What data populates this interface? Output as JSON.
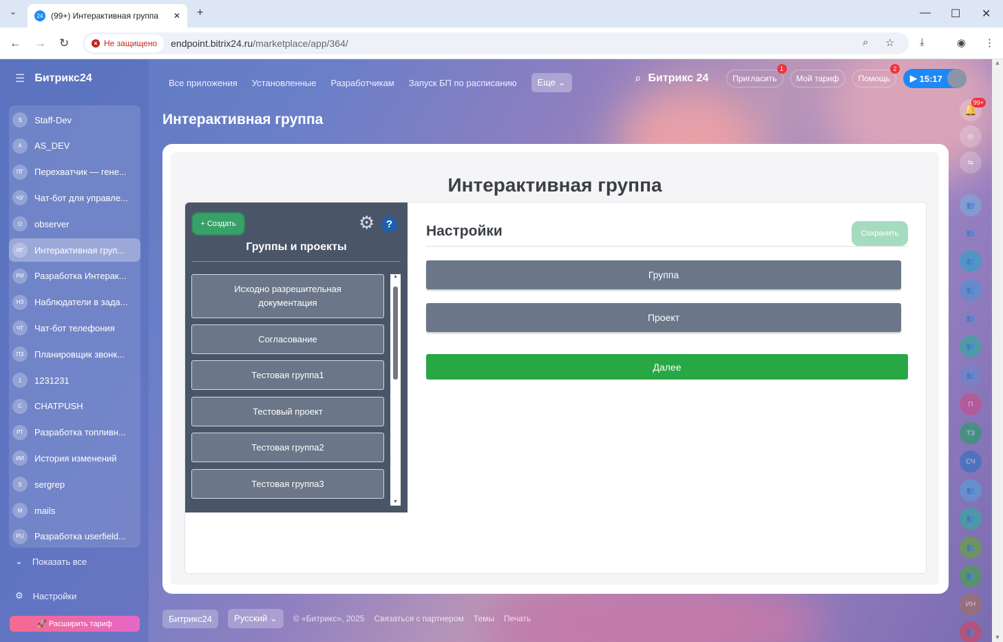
{
  "browser": {
    "tab_title": "(99+) Интерактивная группа",
    "tab_favicon": "24",
    "insecure_label": "Не защищено",
    "url_host": "endpoint.bitrix24.ru",
    "url_path": "/marketplace/app/364/"
  },
  "sidebar": {
    "logo": "Битрикс24",
    "items": [
      {
        "abbr": "S",
        "label": "Staff-Dev"
      },
      {
        "abbr": "A",
        "label": "AS_DEV"
      },
      {
        "abbr": "ПГ",
        "label": "Перехватчик — гене..."
      },
      {
        "abbr": "ЧУ",
        "label": "Чат-бот для управле..."
      },
      {
        "abbr": "O",
        "label": "observer"
      },
      {
        "abbr": "ИГ",
        "label": "Интерактивная груп...",
        "active": true
      },
      {
        "abbr": "РИ",
        "label": "Разработка Интерак..."
      },
      {
        "abbr": "НЗ",
        "label": "Наблюдатели в зада..."
      },
      {
        "abbr": "ЧТ",
        "label": "Чат-бот телефония"
      },
      {
        "abbr": "ПЗ",
        "label": "Планировщик звонк..."
      },
      {
        "abbr": "1",
        "label": "1231231"
      },
      {
        "abbr": "C",
        "label": "CHATPUSH"
      },
      {
        "abbr": "РТ",
        "label": "Разработка топливн..."
      },
      {
        "abbr": "ИИ",
        "label": "История изменений"
      },
      {
        "abbr": "S",
        "label": "sergrep"
      },
      {
        "abbr": "M",
        "label": "mails"
      },
      {
        "abbr": "PU",
        "label": "Разработка userfield..."
      }
    ],
    "show_all": "Показать все",
    "settings": "Настройки",
    "upgrade": "Расширить тариф"
  },
  "topnav": {
    "items": [
      "Все приложения",
      "Установленные",
      "Разработчикам",
      "Запуск БП по расписанию"
    ],
    "more": "Еще",
    "brand": "Битрикс 24",
    "invite": "Пригласить",
    "invite_badge": "1",
    "tariff": "Мой тариф",
    "help": "Помощь",
    "help_badge": "2",
    "time": "15:17"
  },
  "page_title": "Интерактивная группа",
  "app": {
    "heading": "Интерактивная группа",
    "create": "+ Создать",
    "groups_title": "Группы и проекты",
    "groups": [
      "Исходно разрешительная документация",
      "Согласование",
      "Тестовая группа1",
      "Тестовый проект",
      "Тестовая группа2",
      "Тестовая группа3"
    ],
    "settings_title": "Настройки",
    "save": "Сохранить",
    "options": [
      "Группа",
      "Проект"
    ],
    "next": "Далее"
  },
  "footer": {
    "brand": "Битрикс24",
    "lang": "Русский",
    "copyright": "© «Битрикс», 2025",
    "partner": "Связаться с партнером",
    "themes": "Темы",
    "print": "Печать"
  },
  "rightbar": {
    "notif_badge": "99+",
    "items": [
      {
        "label": "",
        "color": "#7fa6d8"
      },
      {
        "label": "",
        "color": "#8f7fc0"
      },
      {
        "label": "",
        "color": "#3a9fc8"
      },
      {
        "label": "",
        "color": "#5a8fd0"
      },
      {
        "label": "",
        "color": "#8a7cc0"
      },
      {
        "label": "",
        "color": "#3aa7a0"
      },
      {
        "label": "",
        "color": "#6f86c8"
      },
      {
        "label": "П",
        "color": "#c2508e"
      },
      {
        "label": "ТЗ",
        "color": "#2e9a6e"
      },
      {
        "label": "СЧ",
        "color": "#3a72c0"
      },
      {
        "label": "",
        "color": "#5c9ad8"
      },
      {
        "label": "",
        "color": "#3aa7a0"
      },
      {
        "label": "",
        "color": "#6aa040"
      },
      {
        "label": "",
        "color": "#4aa050"
      },
      {
        "label": "ИН",
        "color": "#a0706a"
      },
      {
        "label": "",
        "color": "#c84a6a"
      }
    ]
  }
}
